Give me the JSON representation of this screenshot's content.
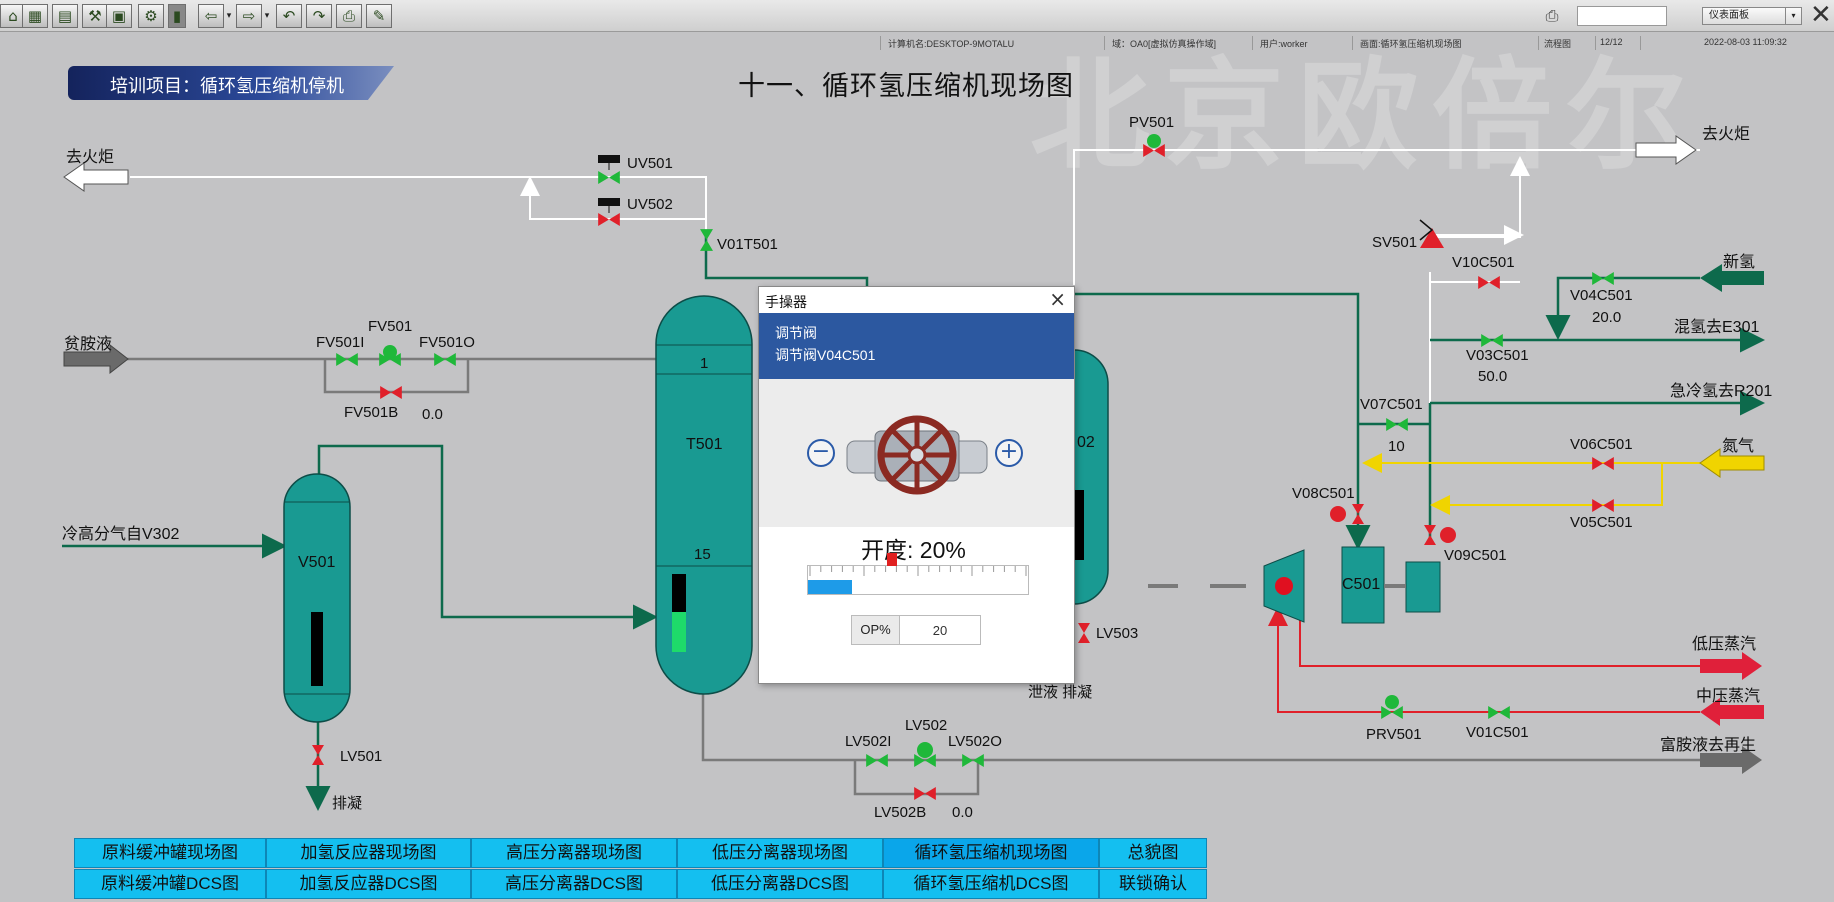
{
  "toolbar": {
    "buttons": [
      "home-icon",
      "grid-icon",
      "table-icon",
      "process-icon",
      "chart-icon",
      "tools-icon",
      "clipboard-icon",
      "back-icon",
      "forward-icon",
      "undo-icon",
      "redo-icon",
      "print-preview-icon",
      "pen-icon"
    ],
    "view_select": "仪表面板"
  },
  "statusbar": {
    "computer": "计算机名:DESKTOP-9MOTALU",
    "domain": "域：OA0[虚拟仿真操作域]",
    "user": "用户:worker",
    "screen": "画面:循环氢压缩机现场图",
    "flow": "流程图",
    "page": "12/12",
    "datetime": "2022-08-03 11:09:32"
  },
  "header": {
    "project": "培训项目：循环氢压缩机停机",
    "title": "十一、循环氢压缩机现场图",
    "watermark": "北京欧倍尔"
  },
  "streams": {
    "to_flare_left": "去火炬",
    "to_flare_right": "去火炬",
    "lean_amine": "贫胺液",
    "cold_hp_gas": "冷高分气自V302",
    "drain_left": "排凝",
    "fresh_h2": "新氢",
    "mix_h2": "混氢去E301",
    "quench_h2": "急冷氢去R201",
    "nitrogen": "氮气",
    "lp_steam": "低压蒸汽",
    "mp_steam": "中压蒸汽",
    "rich_amine": "富胺液去再生",
    "drain_bottom": "泄液 排凝"
  },
  "valves": {
    "UV501": "UV501",
    "UV502": "UV502",
    "V01T501": "V01T501",
    "FV501": "FV501",
    "FV501I": "FV501I",
    "FV501O": "FV501O",
    "FV501B": "FV501B",
    "FV501B_val": "0.0",
    "LV501": "LV501",
    "PV501": "PV501",
    "SV501": "SV501",
    "V10C501": "V10C501",
    "V04C501": "V04C501",
    "V04C501_val": "20.0",
    "V03C501": "V03C501",
    "V03C501_val": "50.0",
    "V07C501": "V07C501",
    "V07C501_val": "10",
    "V06C501": "V06C501",
    "V05C501": "V05C501",
    "V08C501": "V08C501",
    "V09C501": "V09C501",
    "LV503": "LV503",
    "LV502": "LV502",
    "LV502I": "LV502I",
    "LV502O": "LV502O",
    "LV502B": "LV502B",
    "LV502B_val": "0.0",
    "PRV501": "PRV501",
    "V01C501": "V01C501"
  },
  "equipment": {
    "V501": "V501",
    "T501": "T501",
    "C501": "C501",
    "V502_partial": "02",
    "tray_top": "1",
    "tray_bottom": "15"
  },
  "levels": {
    "V501": 0.45,
    "T501_black": 0.55,
    "T501_green": 0.35
  },
  "dialog": {
    "title": "手操器",
    "type": "调节阀",
    "name": "调节阀V04C501",
    "opening_label": "开度: 20%",
    "opening": 0.2,
    "op_label": "OP%",
    "op_value": "20"
  },
  "nav": {
    "row1": [
      "原料缓冲罐现场图",
      "加氢反应器现场图",
      "高压分离器现场图",
      "低压分离器现场图",
      "循环氢压缩机现场图",
      "总貌图"
    ],
    "row2": [
      "原料缓冲罐DCS图",
      "加氢反应器DCS图",
      "高压分离器DCS图",
      "低压分离器DCS图",
      "循环氢压缩机DCS图",
      "联锁确认"
    ],
    "active": "循环氢压缩机现场图"
  },
  "colors": {
    "line_green": "#0d6a4c",
    "line_white": "#ffffff",
    "line_grey": "#7a7a7a",
    "line_red": "#e0202a",
    "line_yellow": "#f0d400",
    "vessel": "#199a92",
    "valve_green": "#1fb83a",
    "valve_red": "#e0202a"
  }
}
